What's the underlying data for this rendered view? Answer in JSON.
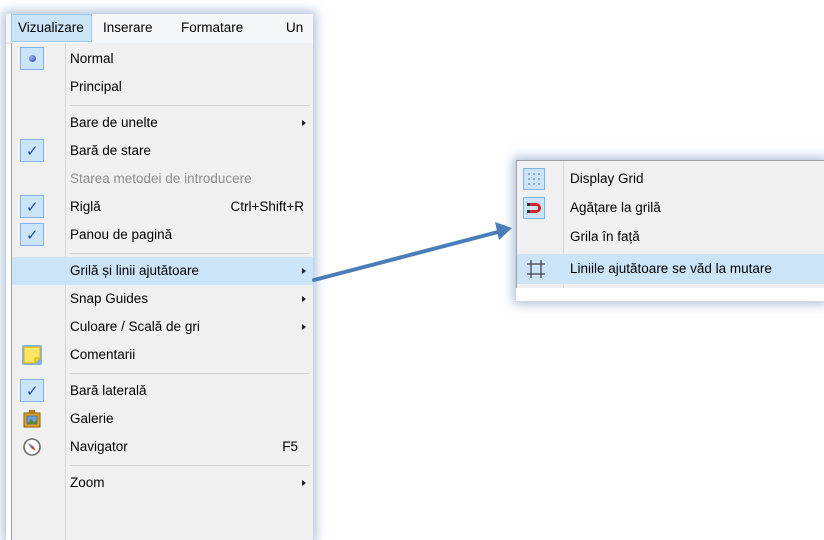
{
  "menubar": {
    "items": [
      {
        "label": "Vizualizare",
        "active": true
      },
      {
        "label": "Inserare"
      },
      {
        "label": "Formatare"
      },
      {
        "label": "Un"
      }
    ]
  },
  "view_menu": {
    "items": [
      {
        "label": "Normal",
        "mark": "radio-dot"
      },
      {
        "label": "Principal"
      },
      {
        "label": "Bare de unelte",
        "submenu": true
      },
      {
        "label": "Bară de stare",
        "mark": "check"
      },
      {
        "label": "Starea metodei de introducere",
        "disabled": true
      },
      {
        "label": "Riglă",
        "mark": "check",
        "shortcut": "Ctrl+Shift+R"
      },
      {
        "label": "Panou de pagină",
        "mark": "check"
      },
      {
        "label": "Grilă și linii ajutătoare",
        "submenu": true,
        "highlighted": true
      },
      {
        "label": "Snap Guides",
        "submenu": true
      },
      {
        "label": "Culoare / Scală de gri",
        "submenu": true
      },
      {
        "label": "Comentarii",
        "icon": "sticky-note-icon"
      },
      {
        "label": "Bară laterală",
        "mark": "check"
      },
      {
        "label": "Galerie",
        "icon": "gallery-icon"
      },
      {
        "label": "Navigator",
        "icon": "compass-icon",
        "shortcut": "F5"
      },
      {
        "label": "Zoom",
        "submenu": true
      }
    ]
  },
  "grid_submenu": {
    "items": [
      {
        "label": "Display Grid",
        "icon": "grid-dots-icon"
      },
      {
        "label": "Agățare la grilă",
        "icon": "magnet-icon"
      },
      {
        "label": "Grila în față"
      },
      {
        "label": "Liniile ajutătoare se văd la mutare",
        "icon": "crosshair-guides-icon",
        "highlighted": true
      }
    ]
  },
  "colors": {
    "highlight": "#cce4f7",
    "check_border": "#7eb4ea",
    "arrow": "#4a7ebb",
    "menu_bg": "#f0f0f0"
  }
}
